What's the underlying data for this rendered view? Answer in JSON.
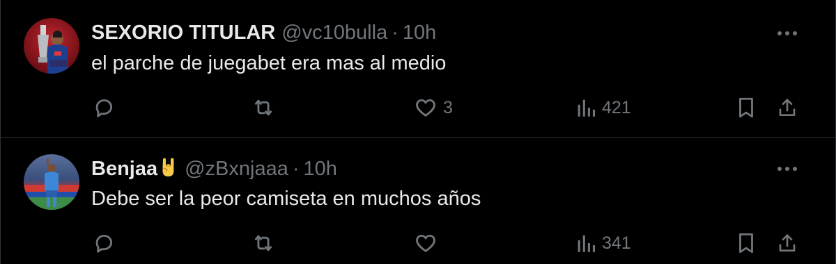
{
  "tweets": [
    {
      "display_name": "SEXORIO TITULAR",
      "handle": "@vc10bulla",
      "separator": "·",
      "time": "10h",
      "text": "el parche de juegabet era mas al medio",
      "avatar_icon": "avatar-photo-player-holding-trophy",
      "name_emoji": "",
      "replies": "",
      "reposts": "",
      "likes": "3",
      "views": "421"
    },
    {
      "display_name": "Benjaa",
      "handle": "@zBxnjaaa",
      "separator": "·",
      "time": "10h",
      "text": "Debe ser la peor camiseta en muchos años",
      "avatar_icon": "avatar-photo-player-on-pitch",
      "name_emoji": "sign-of-the-horns-emoji",
      "replies": "",
      "reposts": "",
      "likes": "",
      "views": "341"
    }
  ],
  "icons": {
    "reply": "reply-icon",
    "repost": "repost-icon",
    "like": "heart-icon",
    "views": "views-chart-icon",
    "bookmark": "bookmark-icon",
    "share": "share-icon",
    "more": "more-options-icon"
  },
  "colors": {
    "background": "#000000",
    "text_primary": "#e7e9ea",
    "text_secondary": "#71767b",
    "divider": "#2f3336"
  }
}
